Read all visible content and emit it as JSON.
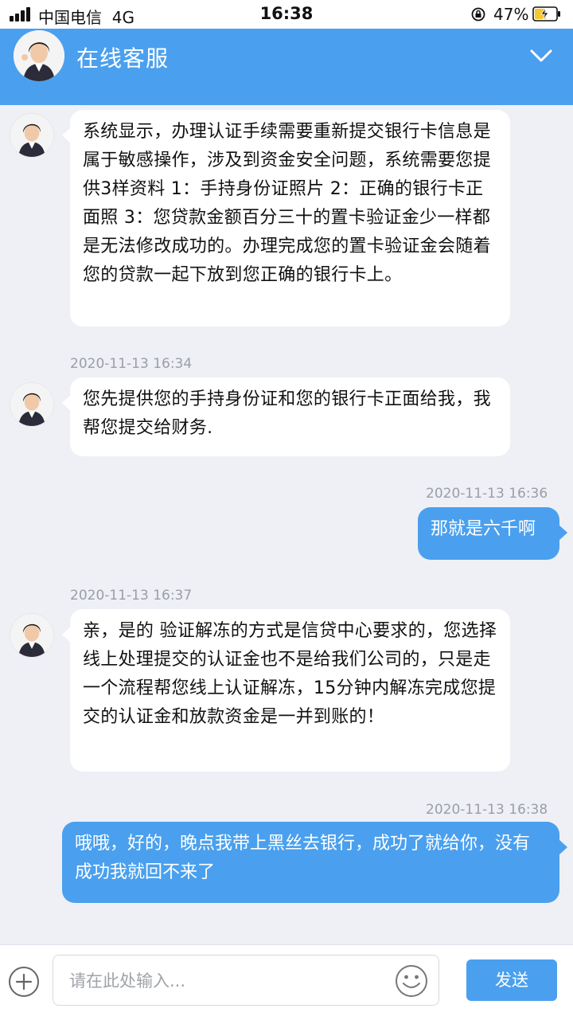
{
  "status_bar": {
    "carrier": "中国电信",
    "network": "4G",
    "time": "16:38",
    "battery": "47%"
  },
  "header": {
    "title": "在线客服"
  },
  "messages": [
    {
      "side": "agent",
      "text": "系统显示，办理认证手续需要重新提交银行卡信息是属于敏感操作，涉及到资金安全问题，系统需要您提供3样资料 1：手持身份证照片 2：正确的银行卡正面照 3：您贷款金额百分三十的置卡验证金少一样都是无法修改成功的。办理完成您的置卡验证金会随着您的贷款一起下放到您正确的银行卡上。"
    },
    {
      "timestamp": "2020-11-13 16:34"
    },
    {
      "side": "agent",
      "text": "您先提供您的手持身份证和您的银行卡正面给我，我帮您提交给财务."
    },
    {
      "timestamp": "2020-11-13 16:36"
    },
    {
      "side": "user",
      "text": "那就是六千啊"
    },
    {
      "timestamp": "2020-11-13 16:37"
    },
    {
      "side": "agent",
      "text": "亲，是的 验证解冻的方式是信贷中心要求的，您选择线上处理提交的认证金也不是给我们公司的，只是走一个流程帮您线上认证解冻，15分钟内解冻完成您提交的认证金和放款资金是一并到账的！"
    },
    {
      "timestamp": "2020-11-13 16:38"
    },
    {
      "side": "user",
      "text": "哦哦，好的，晚点我带上黑丝去银行，成功了就给你，没有成功我就回不来了"
    }
  ],
  "input": {
    "placeholder": "请在此处输入...",
    "send_label": "发送"
  },
  "colors": {
    "accent": "#4aa0ee",
    "background": "#eef0f5"
  },
  "icons": [
    "signal-icon",
    "lock-rotation-icon",
    "battery-charging-icon",
    "chevron-down-icon",
    "plus-icon",
    "emoji-icon"
  ]
}
